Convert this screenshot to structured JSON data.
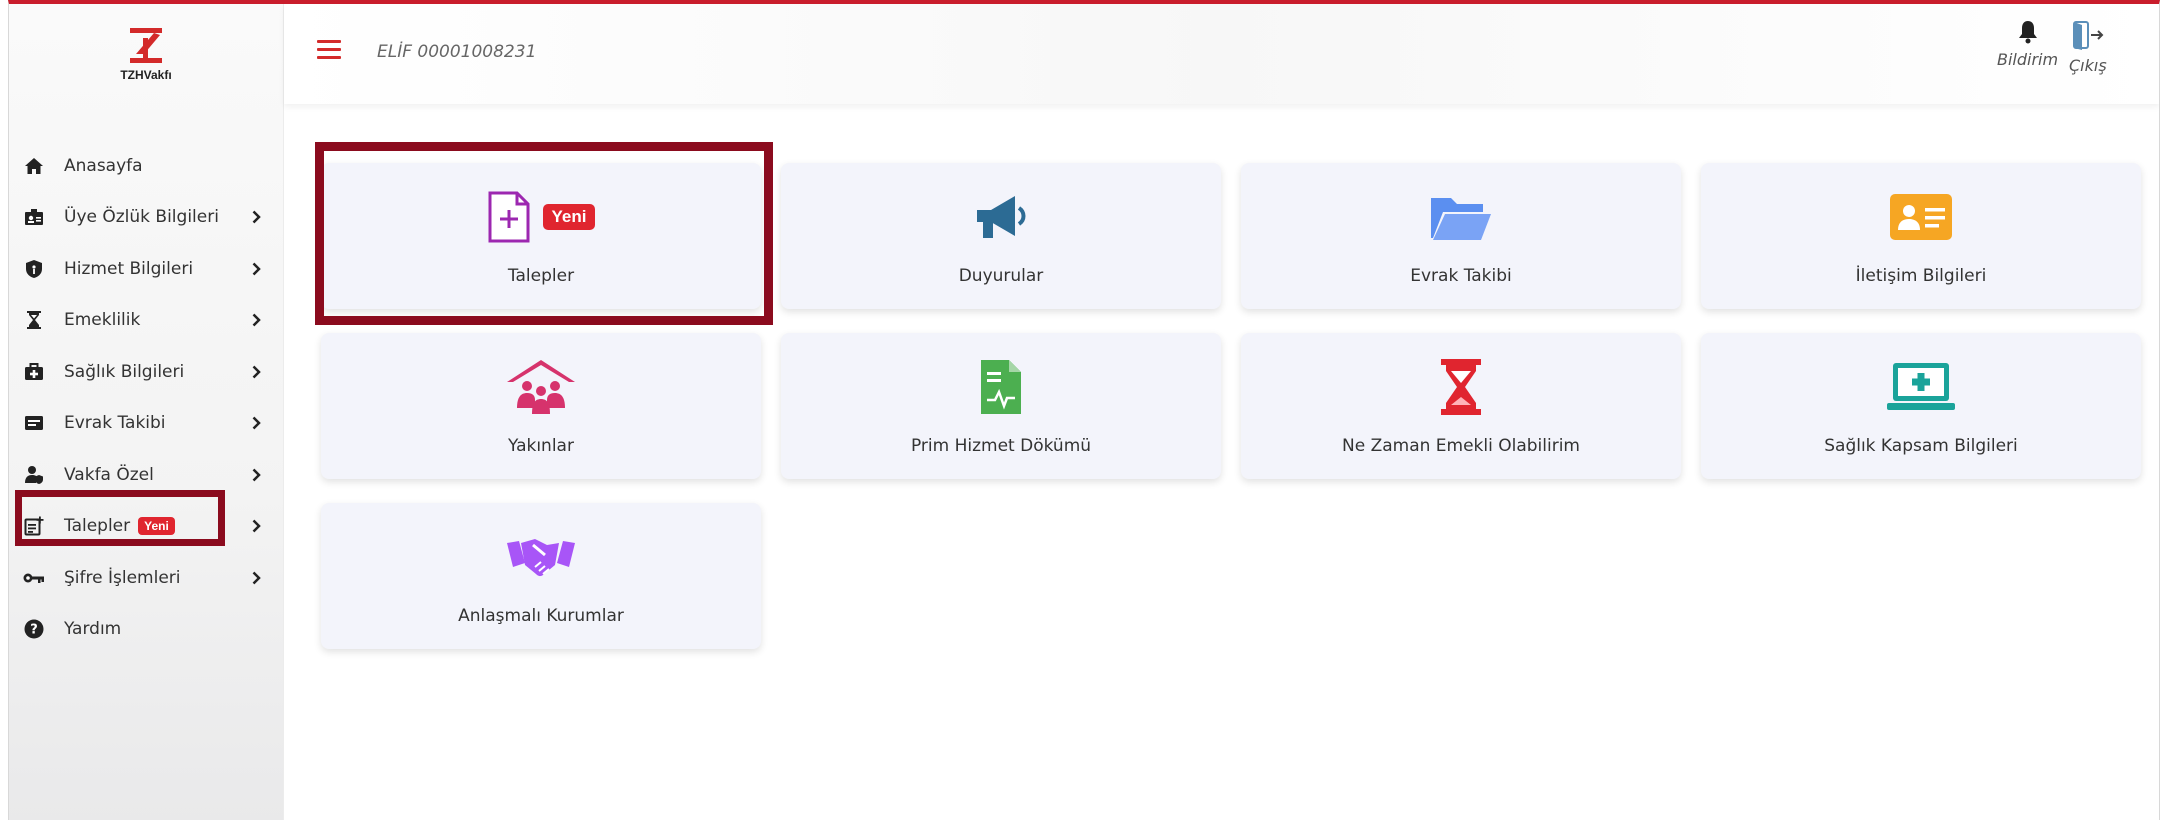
{
  "brand": {
    "name": "TZHVakfı"
  },
  "header": {
    "user_id": "ELİF 00001008231",
    "notifications_label": "Bildirim",
    "logout_label": "Çıkış"
  },
  "sidebar": {
    "items": [
      {
        "label": "Anasayfa",
        "icon": "home-icon",
        "has_chevron": false
      },
      {
        "label": "Üye Özlük Bilgileri",
        "icon": "id-badge-icon",
        "has_chevron": true
      },
      {
        "label": "Hizmet Bilgileri",
        "icon": "shield-icon",
        "has_chevron": true
      },
      {
        "label": "Emeklilik",
        "icon": "hourglass-icon",
        "has_chevron": true
      },
      {
        "label": "Sağlık Bilgileri",
        "icon": "medical-kit-icon",
        "has_chevron": true
      },
      {
        "label": "Evrak Takibi",
        "icon": "document-icon",
        "has_chevron": true
      },
      {
        "label": "Vakfa Özel",
        "icon": "user-shield-icon",
        "has_chevron": true
      },
      {
        "label": "Talepler",
        "icon": "request-icon",
        "has_chevron": true,
        "badge": "Yeni",
        "highlighted": true
      },
      {
        "label": "Şifre İşlemleri",
        "icon": "key-icon",
        "has_chevron": true
      },
      {
        "label": "Yardım",
        "icon": "help-icon",
        "has_chevron": false
      }
    ]
  },
  "cards": [
    {
      "label": "Talepler",
      "icon": "add-document-icon",
      "badge": "Yeni",
      "highlighted": true,
      "color": "#9c27b0"
    },
    {
      "label": "Duyurular",
      "icon": "megaphone-icon",
      "color": "#2c6b94"
    },
    {
      "label": "Evrak Takibi",
      "icon": "folder-open-icon",
      "color": "#5b8ff0"
    },
    {
      "label": "İletişim Bilgileri",
      "icon": "contact-card-icon",
      "color": "#f6a623"
    },
    {
      "label": "Yakınlar",
      "icon": "family-house-icon",
      "color": "#d6336c"
    },
    {
      "label": "Prim Hizmet Dökümü",
      "icon": "medical-file-icon",
      "color": "#4caf50"
    },
    {
      "label": "Ne Zaman Emekli Olabilirim",
      "icon": "hourglass-icon",
      "color": "#e0252f"
    },
    {
      "label": "Sağlık Kapsam Bilgileri",
      "icon": "laptop-medical-icon",
      "color": "#1aa39a"
    },
    {
      "label": "Anlaşmalı Kurumlar",
      "icon": "handshake-icon",
      "color": "#a855f7"
    }
  ],
  "colors": {
    "accent": "#c91d2c",
    "highlight_border": "#8b0b1e",
    "badge": "#e0252f",
    "card_bg": "#f3f4fb"
  }
}
